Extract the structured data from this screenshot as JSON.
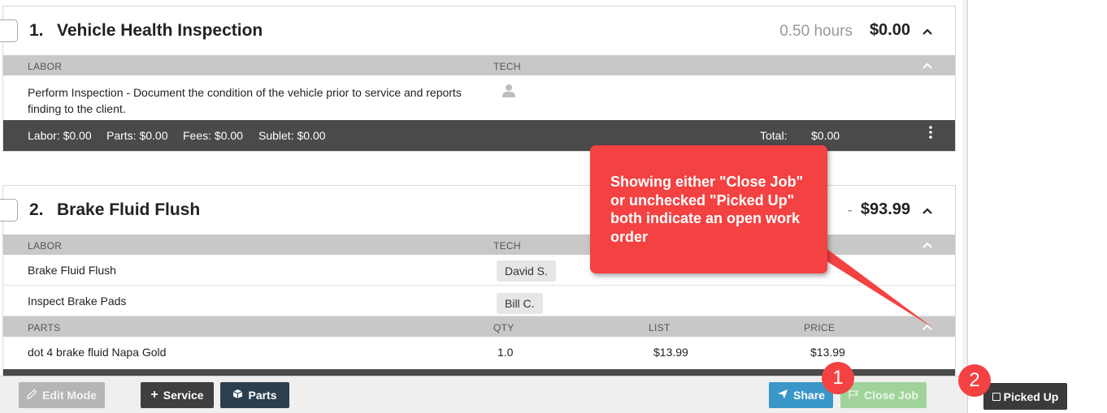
{
  "job1": {
    "number": "1.",
    "title": "Vehicle Health Inspection",
    "hours": "0.50 hours",
    "price": "$0.00",
    "chevron": "^",
    "labor_header": "LABOR",
    "tech_header": "TECH",
    "labor_items": [
      {
        "description_line1": "Perform Inspection - Document the condition of the vehicle prior to service and reports",
        "description_line2": "finding to the client."
      }
    ],
    "summary": {
      "labor": "Labor: $0.00",
      "parts": "Parts: $0.00",
      "fees": "Fees: $0.00",
      "sublet": "Sublet: $0.00",
      "total_label": "Total:",
      "total_value": "$0.00"
    }
  },
  "job2": {
    "number": "2.",
    "title": "Brake Fluid Flush",
    "hours": "-",
    "price": "$93.99",
    "chevron": "^",
    "labor_header": "LABOR",
    "tech_header": "TECH",
    "labor_items": [
      {
        "description": "Brake Fluid Flush",
        "tech": "David S."
      },
      {
        "description": "Inspect Brake Pads",
        "tech": "Bill C."
      }
    ],
    "parts_header": "PARTS",
    "qty_header": "QTY",
    "list_header": "LIST",
    "price_header": "PRICE",
    "parts": [
      {
        "name": "dot 4 brake fluid Napa Gold",
        "qty": "1.0",
        "list": "$13.99",
        "price": "$13.99"
      }
    ]
  },
  "callout": {
    "text": "Showing either \"Close Job\" or unchecked \"Picked Up\" both indicate an open work order"
  },
  "markers": {
    "one": "1",
    "two": "2"
  },
  "toolbar": {
    "edit_mode": "Edit Mode",
    "service": "Service",
    "parts": "Parts",
    "share": "Share",
    "close_job": "Close Job",
    "picked_up": "Picked Up"
  },
  "colors": {
    "callout": "#f44141",
    "share": "#3a97c9",
    "close_job": "#9fd39a",
    "summary_bar": "#4a4a4a"
  }
}
